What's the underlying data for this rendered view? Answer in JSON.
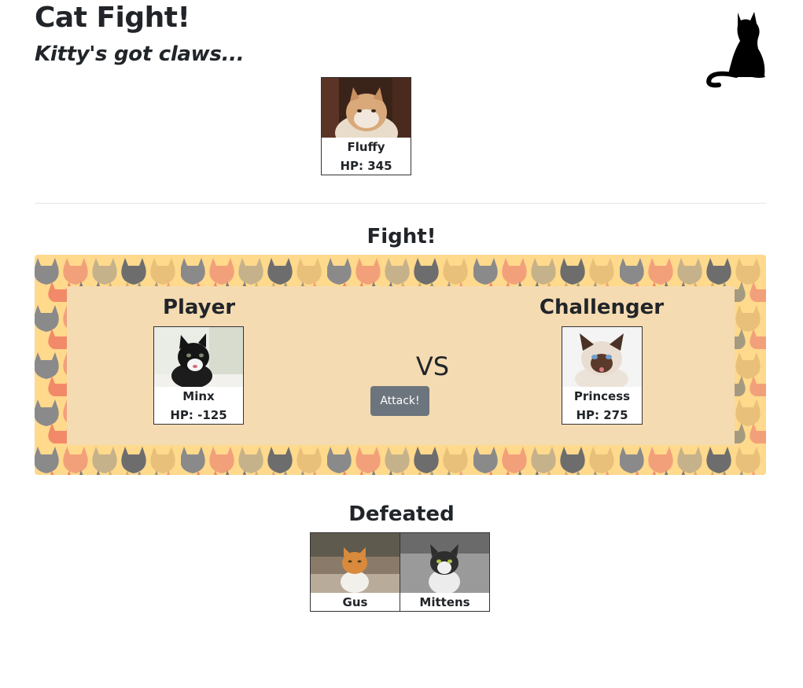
{
  "header": {
    "title": "Cat Fight!",
    "subtitle": "Kitty's got claws...",
    "logo_icon": "cat-silhouette-icon"
  },
  "roster": [
    {
      "name": "Fluffy",
      "hp": "HP: 345"
    }
  ],
  "fight": {
    "heading": "Fight!",
    "player_label": "Player",
    "challenger_label": "Challenger",
    "vs_label": "VS",
    "attack_label": "Attack!",
    "player": {
      "name": "Minx",
      "hp": "HP: -125"
    },
    "challenger": {
      "name": "Princess",
      "hp": "HP: 275"
    }
  },
  "defeated": {
    "heading": "Defeated",
    "cats": [
      {
        "name": "Gus"
      },
      {
        "name": "Mittens"
      }
    ]
  },
  "colors": {
    "arena_bg": "#ffd98c",
    "arena_inner": "#f5dbb2",
    "button": "#6c757d"
  }
}
